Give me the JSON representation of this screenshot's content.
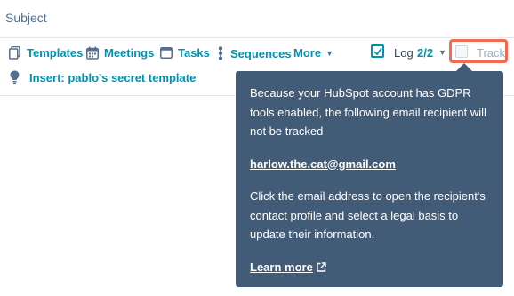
{
  "subject": {
    "label": "Subject"
  },
  "toolbar": {
    "templates": "Templates",
    "meetings": "Meetings",
    "tasks": "Tasks",
    "sequences": "Sequences",
    "more": "More",
    "log_label": "Log",
    "log_count": "2/2",
    "track_label": "Track"
  },
  "insert": {
    "text": "Insert: pablo's secret template"
  },
  "tooltip": {
    "message": "Because your HubSpot account has GDPR tools enabled, the following email recipient will not be tracked",
    "email": "harlow.the.cat@gmail.com",
    "instructions": "Click the email address to open the recipient's contact profile and select a legal basis to update their information.",
    "learn_more": "Learn more"
  },
  "colors": {
    "accent": "#0091ae",
    "tooltip_bg": "#425b76",
    "highlight": "#ef6b51",
    "text": "#33475b"
  },
  "icons": [
    "templates-icon",
    "meetings-icon",
    "tasks-icon",
    "sequences-icon",
    "lightbulb-icon",
    "checkmark-icon",
    "external-link-icon"
  ]
}
